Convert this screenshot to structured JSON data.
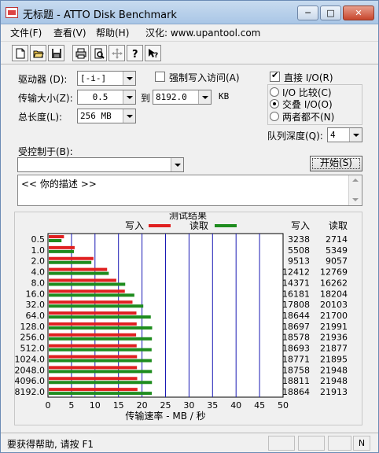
{
  "window": {
    "title": "无标题 - ATTO Disk Benchmark",
    "controls": {
      "minimize": "─",
      "maximize": "□",
      "close": "✕"
    }
  },
  "menu": {
    "file": "文件(F)",
    "view": "查看(V)",
    "help": "帮助(H)",
    "localized": "汉化: www.upantool.com"
  },
  "toolbar": {
    "icons": [
      "new-document-icon",
      "open-folder-icon",
      "save-disk-icon",
      "print-icon",
      "print-preview-icon",
      "move-crosshair-icon",
      "help-question-icon",
      "context-help-icon"
    ]
  },
  "settings": {
    "drive_label": "驱动器 (D):",
    "drive_value": "[-i-]",
    "force_write_label": "强制写入访问(A)",
    "transfer_size_label": "传输大小(Z):",
    "transfer_from": "0.5",
    "to_label": "到",
    "transfer_to": "8192.0",
    "kb_label": "KB",
    "total_length_label": "总长度(L):",
    "total_length_value": "256 MB",
    "direct_io_label": "直接 I/O(R)",
    "io_compare_label": "I/O 比较(C)",
    "overlapped_io_label": "交叠 I/O(O)",
    "neither_label": "两者都不(N)",
    "queue_depth_label": "队列深度(Q):",
    "queue_depth_value": "4",
    "controlled_by_label": "受控制于(B):",
    "controlled_by_value": "",
    "start_button": "开始(S)",
    "description": "<<   你的描述   >>"
  },
  "results": {
    "title": "测试结果",
    "write_legend": "写入",
    "read_legend": "读取",
    "write_header": "写入",
    "read_header": "读取",
    "write_color": "#e02020",
    "read_color": "#1e8c1e",
    "grid_color": "#1a1ab4"
  },
  "chart_data": {
    "type": "bar",
    "orientation": "horizontal",
    "title": "测试结果",
    "xlabel": "传输速率 - MB / 秒",
    "ylabel": "",
    "xlim": [
      0,
      50
    ],
    "xticks": [
      0,
      5,
      10,
      15,
      20,
      25,
      30,
      35,
      40,
      45,
      50
    ],
    "categories": [
      "0.5",
      "1.0",
      "2.0",
      "4.0",
      "8.0",
      "16.0",
      "32.0",
      "64.0",
      "128.0",
      "256.0",
      "512.0",
      "1024.0",
      "2048.0",
      "4096.0",
      "8192.0"
    ],
    "series": [
      {
        "name": "写入",
        "values": [
          3238,
          5508,
          9513,
          12412,
          14371,
          16181,
          17808,
          18644,
          18697,
          18578,
          18693,
          18771,
          18758,
          18811,
          18864
        ]
      },
      {
        "name": "读取",
        "values": [
          2714,
          5349,
          9057,
          12769,
          16262,
          18204,
          20103,
          21700,
          21991,
          21936,
          21877,
          21895,
          21948,
          21948,
          21913
        ]
      }
    ]
  },
  "status": {
    "text": "要获得帮助, 请按 F1",
    "indicator": "N"
  }
}
